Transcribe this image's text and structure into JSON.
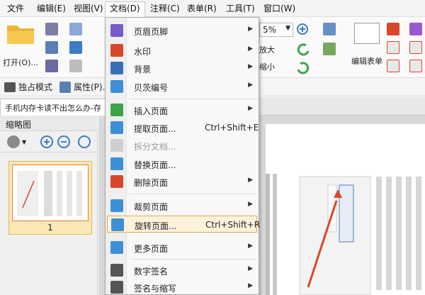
{
  "menubar": {
    "items": [
      "文件",
      "编辑(E)",
      "视图(V)",
      "文档(D)",
      "注释(C)",
      "表单(R)",
      "工具(T)",
      "窗口(W)"
    ]
  },
  "ribbon": {
    "open_label": "打开(O)...",
    "zoom_value": "5%",
    "zoom_in_label": "放大",
    "zoom_out_label": "缩小",
    "edit_form_label": "编辑表单"
  },
  "bar2": {
    "exclusive_mode": "独占模式",
    "properties": "属性(P)..."
  },
  "tab": {
    "title": "手机内存卡读不出怎么办-存"
  },
  "thumbs": {
    "title": "缩略图",
    "page_number": "1"
  },
  "menu": {
    "items": [
      {
        "label": "页眉页脚",
        "shortcut": "",
        "submenu": true,
        "icon": "header-footer-icon",
        "color": "#7a5bc7"
      },
      {
        "label": "水印",
        "shortcut": "",
        "submenu": true,
        "icon": "watermark-icon",
        "color": "#d9472b"
      },
      {
        "label": "背景",
        "shortcut": "",
        "submenu": true,
        "icon": "background-icon",
        "color": "#3a6fb8"
      },
      {
        "label": "贝茨编号",
        "shortcut": "",
        "submenu": true,
        "icon": "bates-number-icon",
        "color": "#3d8fd6"
      },
      {
        "label": "插入页面",
        "shortcut": "",
        "submenu": true,
        "icon": "insert-page-icon",
        "color": "#3aa44a"
      },
      {
        "label": "提取页面...",
        "shortcut": "Ctrl+Shift+E",
        "submenu": false,
        "icon": "extract-page-icon",
        "color": "#3d8fd6"
      },
      {
        "label": "拆分文档...",
        "shortcut": "",
        "submenu": false,
        "icon": "split-doc-icon",
        "color": "#b9b9b9",
        "disabled": true
      },
      {
        "label": "替换页面...",
        "shortcut": "",
        "submenu": false,
        "icon": "replace-page-icon",
        "color": "#3d8fd6"
      },
      {
        "label": "删除页面",
        "shortcut": "",
        "submenu": true,
        "icon": "delete-page-icon",
        "color": "#d9472b"
      },
      {
        "label": "裁剪页面",
        "shortcut": "",
        "submenu": true,
        "icon": "crop-page-icon",
        "color": "#3d8fd6"
      },
      {
        "label": "旋转页面...",
        "shortcut": "Ctrl+Shift+R",
        "submenu": false,
        "icon": "rotate-page-icon",
        "color": "#3d8fd6",
        "highlighted": true
      },
      {
        "label": "更多页面",
        "shortcut": "",
        "submenu": true,
        "icon": "more-pages-icon",
        "color": "#3d8fd6"
      },
      {
        "label": "数字签名",
        "shortcut": "",
        "submenu": true,
        "icon": "digital-signature-icon",
        "color": "#555555"
      },
      {
        "label": "签名与缩写",
        "shortcut": "",
        "submenu": true,
        "icon": "sign-initials-icon",
        "color": "#555555"
      }
    ]
  },
  "colors": {
    "accent_orange": "#e9a64b",
    "menu_highlight_bg": "#fdf3dc",
    "thumb_selected_bg": "#fbe8b8"
  }
}
